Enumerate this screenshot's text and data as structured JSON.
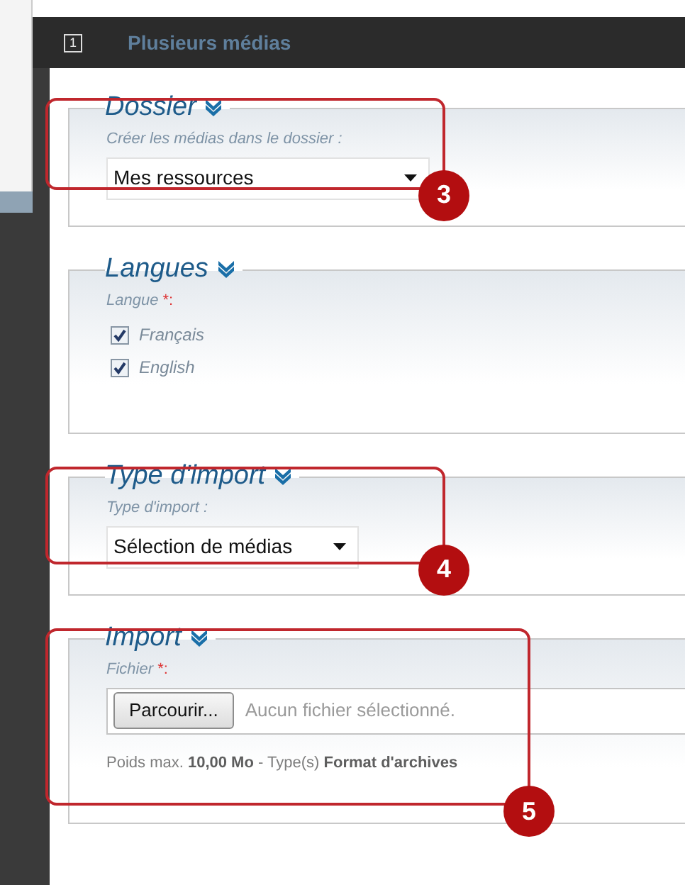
{
  "header": {
    "step": "1",
    "title": "Plusieurs médias"
  },
  "sections": [
    {
      "kind": "select",
      "legend": "Dossier",
      "label": "Créer les médias dans le dossier  :",
      "value": "Mes ressources",
      "callout": "3"
    },
    {
      "kind": "checkboxes",
      "legend": "Langues",
      "label": "Langue",
      "required_mark": "*:",
      "options": [
        {
          "label": "Français",
          "checked": true
        },
        {
          "label": "English",
          "checked": true
        }
      ]
    },
    {
      "kind": "select",
      "legend": "Type d'import",
      "label": "Type d'import  :",
      "value": "Sélection de médias",
      "callout": "4"
    },
    {
      "kind": "file",
      "legend": "Import",
      "label": "Fichier",
      "required_mark": "*:",
      "button": "Parcourir...",
      "status": "Aucun fichier sélectionné.",
      "hint": "Poids max. **10,00 Mo** - Type(s) **Format d'archives**",
      "callout": "5"
    }
  ]
}
